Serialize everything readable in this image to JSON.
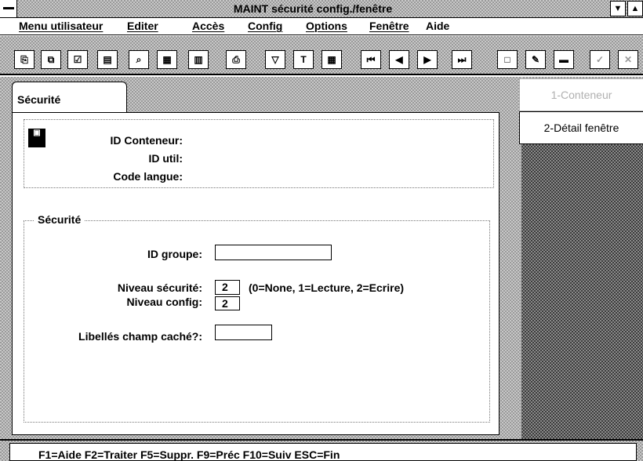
{
  "window": {
    "title": "MAINT sécurité config./fenêtre",
    "sysmenu_icon": "dash-icon",
    "minimize_glyph": "▼",
    "maximize_glyph": "▲"
  },
  "menu": [
    "Menu utilisateur",
    "Editer",
    "Accès",
    "Config",
    "Options",
    "Fenêtre",
    "Aide"
  ],
  "toolbar": {
    "buttons": [
      {
        "icon": "copy-icon",
        "glyph": "⎘"
      },
      {
        "icon": "paste-icon",
        "glyph": "⧉"
      },
      {
        "icon": "checklist-icon",
        "glyph": "☑"
      },
      {
        "icon": "document-icon",
        "glyph": "▤"
      },
      {
        "icon": "zoom-icon",
        "glyph": "⌕"
      },
      {
        "icon": "grid-icon",
        "glyph": "▦"
      },
      {
        "icon": "table-icon",
        "glyph": "▥"
      },
      {
        "icon": "print-icon",
        "glyph": "⎙"
      },
      {
        "icon": "filter-icon",
        "glyph": "▽"
      },
      {
        "icon": "text-icon",
        "glyph": "T"
      },
      {
        "icon": "building-icon",
        "glyph": "▦"
      },
      {
        "icon": "first-icon",
        "glyph": "⏮"
      },
      {
        "icon": "prev-icon",
        "glyph": "◀"
      },
      {
        "icon": "next-icon",
        "glyph": "▶"
      },
      {
        "icon": "last-icon",
        "glyph": "⏭"
      },
      {
        "icon": "new-icon",
        "glyph": "□"
      },
      {
        "icon": "edit-icon",
        "glyph": "✎"
      },
      {
        "icon": "delete-icon",
        "glyph": "▬"
      },
      {
        "icon": "check-icon",
        "glyph": "✓"
      },
      {
        "icon": "cancel-icon",
        "glyph": "✕"
      }
    ]
  },
  "tabs": {
    "main": "Sécurité",
    "container": "1-Conteneur",
    "detail": "2-Détail fenêtre"
  },
  "header": {
    "icon": "container-icon",
    "icon_glyph": "▣",
    "labels": [
      "ID Conteneur:",
      "ID util:",
      "Code langue:"
    ]
  },
  "section": {
    "title": "Sécurité",
    "group_label": "ID groupe:",
    "group_value": "",
    "security_label": "Niveau sécurité:",
    "security_value": "2",
    "security_hint": "(0=None, 1=Lecture, 2=Ecrire)",
    "config_label": "Niveau config:",
    "config_value": "2",
    "hidden_label": "Libellés champ caché?:",
    "hidden_value": ""
  },
  "status": "F1=Aide  F2=Traiter  F5=Suppr.  F9=Préc  F10=Suiv  ESC=Fin"
}
